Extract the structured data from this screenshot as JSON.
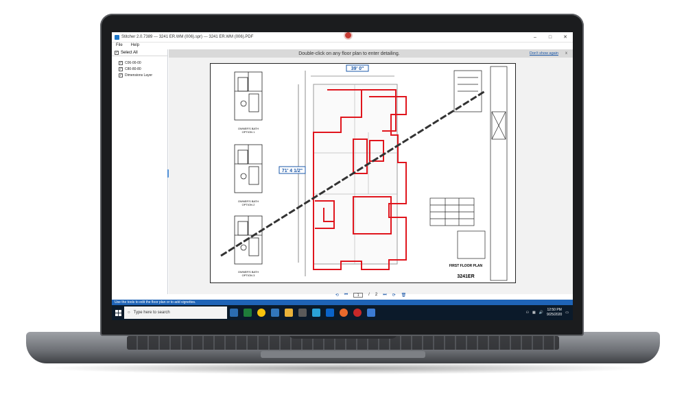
{
  "window": {
    "title": "Stitcher 2.0.7389  ---  3241 ER.WM (006).spr)  ---  3241 ER.WM (006).PDF",
    "minimize": "–",
    "maximize": "□",
    "close": "✕"
  },
  "menu": {
    "items": [
      "File",
      "Help"
    ]
  },
  "sidebar": {
    "select_all": "Select All",
    "layers": [
      {
        "label": "C06-00-00",
        "checked": true
      },
      {
        "label": "C80-80-80",
        "checked": true
      },
      {
        "label": "Dimensions Layer",
        "checked": true
      }
    ]
  },
  "banner": {
    "message": "Double-click on any floor plan to enter detailing.",
    "dont_show": "Don't show again",
    "close": "x"
  },
  "drawing": {
    "dim_top": "39'  0\"",
    "dim_left": "71'  4 1/2\"",
    "option_labels": [
      "OWNER'S BATH\nOPTION 1",
      "OWNER'S BATH\nOPTION 2",
      "OWNER'S BATH\nOPTION 3"
    ],
    "title_block": "FIRST FLOOR PLAN",
    "plan_number": "3241ER"
  },
  "pagination": {
    "current": "1",
    "separator": "/",
    "total": "2"
  },
  "status": {
    "text": "Use the tools to edit the floor plan or to add vignettes."
  },
  "taskbar": {
    "search_placeholder": "Type here to search",
    "time": "12:50 PM",
    "date": "9/25/2020"
  },
  "colors": {
    "accent": "#1f64b7",
    "wall_highlight": "#e0141c",
    "banner": "#d9d9d9",
    "taskbar": "#0b1a2a"
  }
}
